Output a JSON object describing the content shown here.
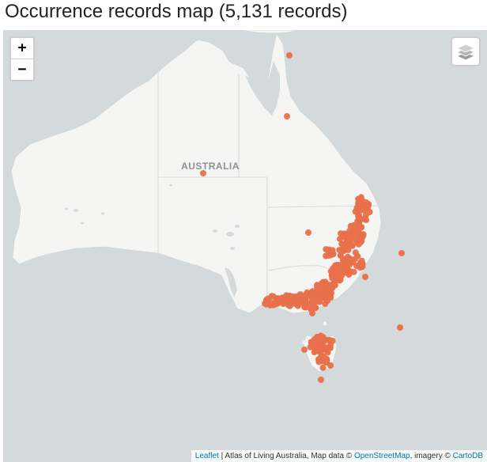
{
  "title": "Occurrence records map (5,131 records)",
  "map": {
    "country_label": "AUSTRALIA",
    "record_count": 5131,
    "marker_color": "#e8704a",
    "land_color": "#f5f5f3",
    "water_color": "#d4dadc"
  },
  "controls": {
    "zoom_in": "+",
    "zoom_out": "−",
    "layers_icon": "layers-icon"
  },
  "attribution": {
    "leaflet": "Leaflet",
    "sep1": " | Atlas of Living Australia, Map data © ",
    "osm": "OpenStreetMap",
    "sep2": ", imagery © ",
    "cartodb": "CartoDB"
  }
}
